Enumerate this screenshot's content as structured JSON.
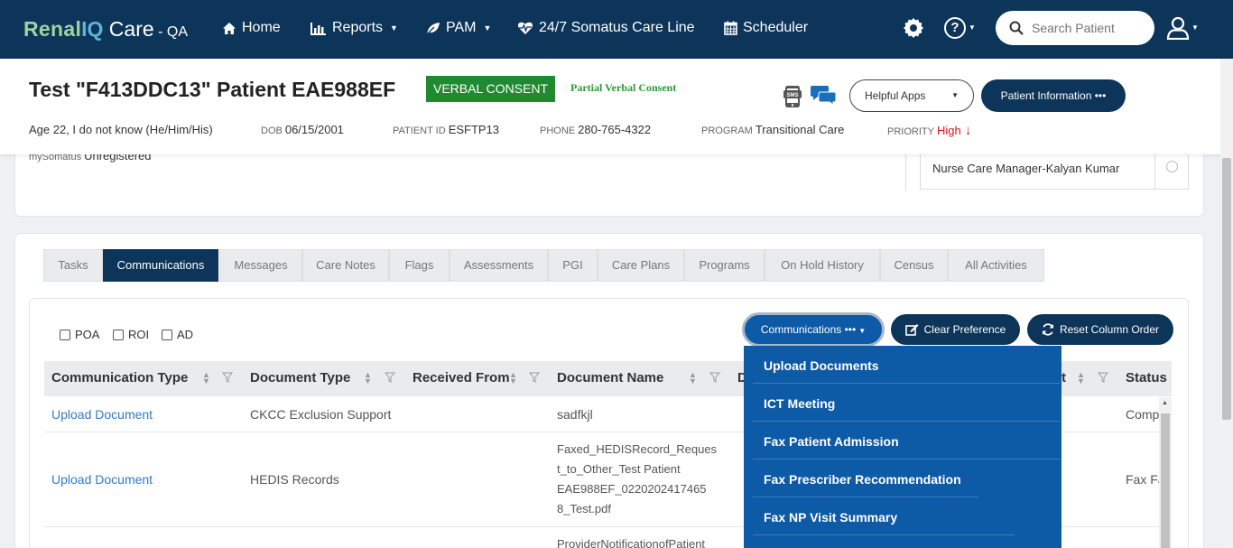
{
  "nav": {
    "brand_renal": "Renal",
    "brand_iq": "IQ",
    "brand_care": " Care",
    "brand_env": " - QA",
    "home": "Home",
    "reports": "Reports",
    "pam": "PAM",
    "careline": "24/7 Somatus Care Line",
    "scheduler": "Scheduler",
    "search_placeholder": "Search Patient",
    "colors": {
      "bar": "#0d3559",
      "brand_green": "#9fd4a2",
      "brand_blue": "#5fb2d6"
    }
  },
  "header": {
    "patient_name": "Test \"F413DDC13\" Patient EAE988EF",
    "consent_badge": "VERBAL CONSENT",
    "partial_consent": "Partial Verbal Consent",
    "helpful_apps": "Helpful Apps",
    "patient_info": "Patient Information •••",
    "age": "Age 22, I do not know (He/Him/His)",
    "dob_label": "DOB",
    "dob": "06/15/2001",
    "pid_label": "PATIENT ID",
    "pid": "ESFTP13",
    "phone_label": "PHONE",
    "phone": "280-765-4322",
    "program_label": "PROGRAM",
    "program": "Transitional Care",
    "priority_label": "PRIORITY",
    "priority": "High",
    "mysomatus_label": "mySomatus",
    "mysomatus": "Unregistered"
  },
  "care_team": {
    "member": "Nurse Care Manager-Kalyan Kumar"
  },
  "tabs": [
    "Tasks",
    "Communications",
    "Messages",
    "Care Notes",
    "Flags",
    "Assessments",
    "PGI",
    "Care Plans",
    "Programs",
    "On Hold History",
    "Census",
    "All Activities"
  ],
  "active_tab": "Communications",
  "filters": {
    "poa": "POA",
    "roi": "ROI",
    "ad": "AD"
  },
  "toolbar": {
    "communications": "Communications •••",
    "clear_pref": "Clear Preference",
    "reset_cols": "Reset Column Order"
  },
  "table": {
    "headers": {
      "comm_type": "Communication Type",
      "doc_type": "Document Type",
      "received_from": "Received From",
      "doc_name": "Document Name",
      "d_col": "D",
      "t_col": "t",
      "status": "Status"
    },
    "rows": [
      {
        "comm_type": "Upload Document",
        "doc_type": "CKCC Exclusion Support",
        "doc_name": [
          "sadfkjl"
        ],
        "status": "Comp"
      },
      {
        "comm_type": "Upload Document",
        "doc_type": "HEDIS Records",
        "doc_name": [
          "Faxed_HEDISRecord_Reques",
          "t_to_Other_Test Patient",
          "EAE988EF_0220202417465",
          "8_Test.pdf"
        ],
        "status": "Fax Fa"
      },
      {
        "comm_type": "",
        "doc_type": "",
        "doc_name": [
          "ProviderNotificationofPatient"
        ],
        "status": ""
      }
    ]
  },
  "dropdown": {
    "items": [
      "Upload Documents",
      "ICT Meeting",
      "Fax Patient Admission",
      "Fax Prescriber Recommendation",
      "Fax NP Visit Summary"
    ]
  }
}
